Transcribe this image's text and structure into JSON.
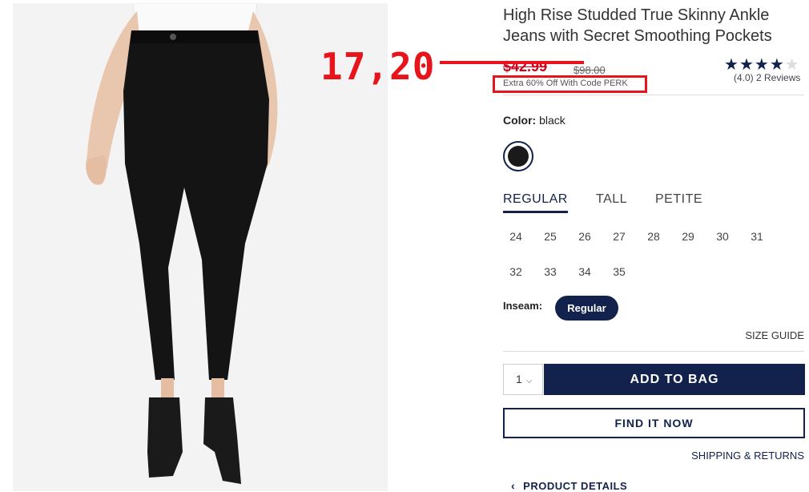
{
  "product": {
    "title": "High Rise Studded True Skinny Ankle Jeans with Secret Smoothing Pockets",
    "sale_price": "$42.99",
    "original_price": "$98.00",
    "promo": "Extra 60% Off With Code PERK",
    "rating_stars_filled": 4,
    "rating_stars_total": 5,
    "reviews_text": "(4.0) 2 Reviews"
  },
  "annotation": {
    "handwritten_price": "17,20",
    "color": "#e8141c"
  },
  "color": {
    "label": "Color:",
    "value": "black",
    "swatch_hex": "#1a1a1a"
  },
  "fit_tabs": [
    "REGULAR",
    "TALL",
    "PETITE"
  ],
  "fit_selected": "REGULAR",
  "sizes": [
    "24",
    "25",
    "26",
    "27",
    "28",
    "29",
    "30",
    "31",
    "32",
    "33",
    "34",
    "35"
  ],
  "inseam": {
    "label": "Inseam:",
    "selected": "Regular"
  },
  "links": {
    "size_guide": "SIZE GUIDE",
    "shipping": "SHIPPING & RETURNS",
    "product_details": "PRODUCT DETAILS"
  },
  "cart": {
    "quantity": "1",
    "add_to_bag": "ADD TO BAG",
    "find_it_now": "FIND IT NOW"
  },
  "colors": {
    "brand_navy": "#12224d",
    "sale_red": "#d0021b"
  },
  "icons": {
    "quantity_dropdown": "chevron-down-icon",
    "details_toggle": "chevron-left-icon",
    "rating": "star-icon"
  }
}
